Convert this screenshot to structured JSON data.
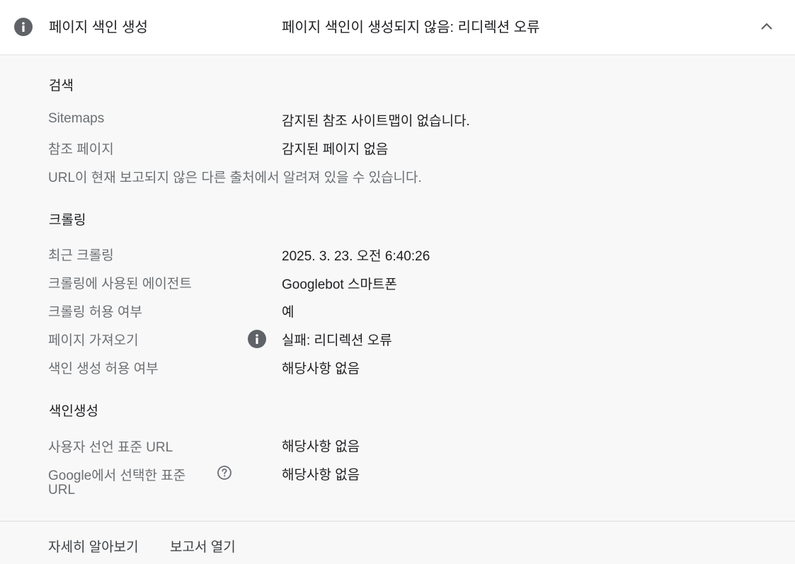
{
  "header": {
    "title": "페이지 색인 생성",
    "status": "페이지 색인이 생성되지 않음: 리디렉션 오류",
    "icon": "info-icon",
    "collapse_icon": "chevron-up-icon"
  },
  "discovery": {
    "title": "검색",
    "rows": [
      {
        "label": "Sitemaps",
        "value": "감지된 참조 사이트맵이 없습니다."
      },
      {
        "label": "참조 페이지",
        "value": "감지된 페이지 없음"
      }
    ],
    "note": "URL이 현재 보고되지 않은 다른 출처에서 알려져 있을 수 있습니다."
  },
  "crawl": {
    "title": "크롤링",
    "rows": [
      {
        "label": "최근 크롤링",
        "value": "2025. 3. 23. 오전 6:40:26"
      },
      {
        "label": "크롤링에 사용된 에이전트",
        "value": "Googlebot 스마트폰"
      },
      {
        "label": "크롤링 허용 여부",
        "value": "예"
      },
      {
        "label": "페이지 가져오기",
        "value": "실패: 리디렉션 오류"
      },
      {
        "label": "색인 생성 허용 여부",
        "value": "해당사항 없음"
      }
    ]
  },
  "indexing": {
    "title": "색인생성",
    "rows": [
      {
        "label": "사용자 선언 표준 URL",
        "value": "해당사항 없음"
      },
      {
        "label_line1": "Google에서 선택한 표준",
        "label_line2": "URL",
        "value": "해당사항 없음"
      }
    ]
  },
  "footer": {
    "learn_more": "자세히 알아보기",
    "open_report": "보고서 열기"
  },
  "colors": {
    "label": "#6b6f73",
    "text": "#202124",
    "icon": "#5f6368",
    "background": "#f8f8f8"
  }
}
